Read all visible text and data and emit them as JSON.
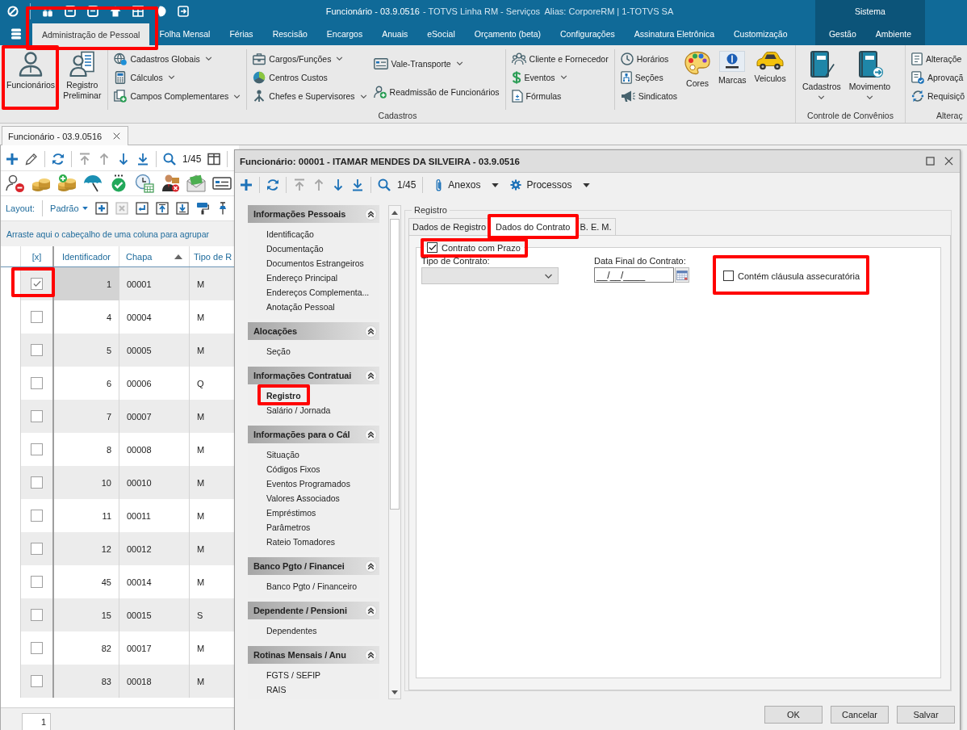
{
  "title_bar": {
    "title": "Funcionário - 03.9.0516",
    "app_info": "- TOTVS Linha RM - Serviços  Alias: CorporeRM | 1-TOTVS SA"
  },
  "ribbon_tabs": [
    {
      "label": "Administração de Pessoal",
      "selected": true,
      "highlighted": true
    },
    {
      "label": "Folha Mensal",
      "selected": false,
      "highlighted": false
    },
    {
      "label": "Férias",
      "selected": false,
      "highlighted": false
    },
    {
      "label": "Rescisão",
      "selected": false,
      "highlighted": false
    },
    {
      "label": "Encargos",
      "selected": false,
      "highlighted": false
    },
    {
      "label": "Anuais",
      "selected": false,
      "highlighted": false
    },
    {
      "label": "eSocial",
      "selected": false,
      "highlighted": false
    },
    {
      "label": "Orçamento (beta)",
      "selected": false,
      "highlighted": false
    },
    {
      "label": "Configurações",
      "selected": false,
      "highlighted": false
    },
    {
      "label": "Assinatura Eletrônica",
      "selected": false,
      "highlighted": false
    },
    {
      "label": "Customização",
      "selected": false,
      "highlighted": false
    }
  ],
  "context_group": {
    "label": "Sistema",
    "tabs": [
      {
        "label": "Gestão",
        "selected": false
      },
      {
        "label": "Ambiente",
        "selected": false
      }
    ]
  },
  "ribbon": {
    "groups": [
      {
        "label": "Cadastros",
        "sections": [
          {
            "columns": [
              {
                "kind": "large",
                "buttons": [
                  {
                    "label": "Funcionários",
                    "dropdown": false,
                    "highlighted": true
                  }
                ]
              },
              {
                "kind": "large",
                "buttons": [
                  {
                    "label": "Registro Preliminar",
                    "dropdown": false
                  }
                ]
              }
            ]
          },
          {
            "columns": [
              {
                "kind": "small",
                "buttons": [
                  {
                    "label": "Cadastros Globais",
                    "dropdown": true
                  },
                  {
                    "label": "Cálculos",
                    "dropdown": true
                  },
                  {
                    "label": "Campos Complementares",
                    "dropdown": true
                  }
                ]
              }
            ]
          },
          {
            "columns": [
              {
                "kind": "small",
                "buttons": [
                  {
                    "label": "Cargos/Funções",
                    "dropdown": true
                  },
                  {
                    "label": "Centros Custos",
                    "dropdown": false
                  },
                  {
                    "label": "Chefes e Supervisores",
                    "dropdown": true
                  }
                ]
              },
              {
                "kind": "small",
                "buttons": [
                  {
                    "label": "Vale-Transporte",
                    "dropdown": true
                  },
                  {
                    "label": "Readmissão de Funcionários",
                    "dropdown": false
                  }
                ]
              }
            ]
          },
          {
            "columns": [
              {
                "kind": "small",
                "buttons": [
                  {
                    "label": "Cliente e Fornecedor",
                    "dropdown": false
                  },
                  {
                    "label": "Eventos",
                    "dropdown": true
                  },
                  {
                    "label": "Fórmulas",
                    "dropdown": false
                  }
                ]
              }
            ]
          },
          {
            "columns": [
              {
                "kind": "small",
                "buttons": [
                  {
                    "label": "Horários",
                    "dropdown": false
                  },
                  {
                    "label": "Seções",
                    "dropdown": false
                  },
                  {
                    "label": "Sindicatos",
                    "dropdown": false
                  }
                ]
              },
              {
                "kind": "large",
                "buttons": [
                  {
                    "label": "Cores",
                    "dropdown": false
                  }
                ]
              },
              {
                "kind": "large",
                "buttons": [
                  {
                    "label": "Marcas",
                    "dropdown": false
                  }
                ]
              },
              {
                "kind": "large",
                "buttons": [
                  {
                    "label": "Veiculos",
                    "dropdown": false
                  }
                ]
              }
            ]
          }
        ]
      },
      {
        "label": "Controle de Convênios",
        "sections": [
          {
            "columns": [
              {
                "kind": "large",
                "buttons": [
                  {
                    "label": "Cadastros",
                    "dropdown": true
                  }
                ]
              },
              {
                "kind": "large",
                "buttons": [
                  {
                    "label": "Movimento",
                    "dropdown": true
                  }
                ]
              }
            ]
          }
        ]
      },
      {
        "label": "Alteraç",
        "sections": [
          {
            "columns": [
              {
                "kind": "small",
                "buttons": [
                  {
                    "label": "Alteraçõe",
                    "dropdown": false
                  },
                  {
                    "label": "Aprovaçã",
                    "dropdown": false
                  },
                  {
                    "label": "Requisiçõ",
                    "dropdown": false
                  }
                ]
              }
            ]
          }
        ]
      }
    ]
  },
  "document_tab": {
    "label": "Funcionário - 03.9.0516"
  },
  "list_panel": {
    "navigation": [
      {
        "kind": "first",
        "disabled": true
      },
      {
        "kind": "previous",
        "disabled": true
      },
      {
        "kind": "next",
        "disabled": false
      },
      {
        "kind": "last",
        "disabled": false
      }
    ],
    "record_counter": "1/45",
    "layout_label": "Layout:",
    "layout_value": "Padrão",
    "group_hint": "Arraste aqui o cabeçalho de uma coluna para agrupar",
    "checkbox_column": {
      "label": "[x]"
    },
    "columns": [
      {
        "label": "Identificador",
        "sorted": false
      },
      {
        "label": "Chapa",
        "sorted": true
      },
      {
        "label": "Tipo de R",
        "sorted": false
      }
    ],
    "rows": [
      {
        "checked": true,
        "selected": true,
        "highlighted": true,
        "cells": [
          "1",
          "00001",
          "M"
        ]
      },
      {
        "checked": false,
        "selected": false,
        "highlighted": false,
        "cells": [
          "4",
          "00004",
          "M"
        ]
      },
      {
        "checked": false,
        "selected": false,
        "highlighted": false,
        "cells": [
          "5",
          "00005",
          "M"
        ]
      },
      {
        "checked": false,
        "selected": false,
        "highlighted": false,
        "cells": [
          "6",
          "00006",
          "Q"
        ]
      },
      {
        "checked": false,
        "selected": false,
        "highlighted": false,
        "cells": [
          "7",
          "00007",
          "M"
        ]
      },
      {
        "checked": false,
        "selected": false,
        "highlighted": false,
        "cells": [
          "8",
          "00008",
          "M"
        ]
      },
      {
        "checked": false,
        "selected": false,
        "highlighted": false,
        "cells": [
          "10",
          "00010",
          "M"
        ]
      },
      {
        "checked": false,
        "selected": false,
        "highlighted": false,
        "cells": [
          "11",
          "00011",
          "M"
        ]
      },
      {
        "checked": false,
        "selected": false,
        "highlighted": false,
        "cells": [
          "12",
          "00012",
          "M"
        ]
      },
      {
        "checked": false,
        "selected": false,
        "highlighted": false,
        "cells": [
          "45",
          "00014",
          "M"
        ]
      },
      {
        "checked": false,
        "selected": false,
        "highlighted": false,
        "cells": [
          "15",
          "00015",
          "S"
        ]
      },
      {
        "checked": false,
        "selected": false,
        "highlighted": false,
        "cells": [
          "82",
          "00017",
          "M"
        ]
      },
      {
        "checked": false,
        "selected": false,
        "highlighted": false,
        "cells": [
          "83",
          "00018",
          "M"
        ]
      }
    ],
    "page_field": "1"
  },
  "dialog": {
    "title": "Funcionário: 00001 - ITAMAR MENDES DA SILVEIRA - 03.9.0516",
    "navigation": [
      {
        "kind": "first",
        "disabled": true
      },
      {
        "kind": "previous",
        "disabled": true
      },
      {
        "kind": "next",
        "disabled": false
      },
      {
        "kind": "last",
        "disabled": false
      }
    ],
    "record_counter": "1/45",
    "menus": [
      {
        "label": "Anexos"
      },
      {
        "label": "Processos"
      }
    ],
    "nav_groups": [
      {
        "label": "Informações Pessoais",
        "expanded": true,
        "items": [
          {
            "label": "Identificação",
            "selected": false
          },
          {
            "label": "Documentação",
            "selected": false
          },
          {
            "label": "Documentos Estrangeiros",
            "selected": false
          },
          {
            "label": "Endereço Principal",
            "selected": false
          },
          {
            "label": "Endereços Complementa...",
            "selected": false
          },
          {
            "label": "Anotação Pessoal",
            "selected": false
          }
        ]
      },
      {
        "label": "Alocações",
        "expanded": true,
        "items": [
          {
            "label": "Seção",
            "selected": false
          }
        ]
      },
      {
        "label": "Informações Contratuai",
        "expanded": true,
        "items": [
          {
            "label": "Registro",
            "selected": true,
            "highlighted": true
          },
          {
            "label": "Salário / Jornada",
            "selected": false,
            "highlighted": false
          }
        ]
      },
      {
        "label": "Informações para o Cál",
        "expanded": true,
        "items": [
          {
            "label": "Situação",
            "selected": false
          },
          {
            "label": "Códigos Fixos",
            "selected": false
          },
          {
            "label": "Eventos Programados",
            "selected": false
          },
          {
            "label": "Valores Associados",
            "selected": false
          },
          {
            "label": "Empréstimos",
            "selected": false
          },
          {
            "label": "Parâmetros",
            "selected": false
          },
          {
            "label": "Rateio Tomadores",
            "selected": false
          }
        ]
      },
      {
        "label": "Banco Pgto / Financei",
        "expanded": true,
        "items": [
          {
            "label": "Banco Pgto / Financeiro",
            "selected": false
          }
        ]
      },
      {
        "label": "Dependente / Pensioni",
        "expanded": true,
        "items": [
          {
            "label": "Dependentes",
            "selected": false
          }
        ]
      },
      {
        "label": "Rotinas Mensais / Anu",
        "expanded": true,
        "items": [
          {
            "label": "FGTS / SEFIP",
            "selected": false
          },
          {
            "label": "RAIS",
            "selected": false
          }
        ]
      }
    ],
    "section_label": "Registro",
    "tabs": [
      {
        "label": "Dados de Registro",
        "selected": false,
        "highlighted": false
      },
      {
        "label": "Dados do Contrato",
        "selected": true,
        "highlighted": true
      },
      {
        "label": "B. E. M.",
        "selected": false,
        "highlighted": false
      }
    ],
    "term_contract": {
      "label": "Contrato com Prazo",
      "checked": true,
      "highlighted": true
    },
    "contract_type": {
      "label": "Tipo de Contrato:",
      "disabled": true
    },
    "end_date": {
      "label": "Data Final do Contrato:",
      "value": "__/__/____"
    },
    "clause": {
      "label": "Contém cláusula assecuratória",
      "checked": false,
      "highlighted": true
    },
    "buttons": [
      {
        "label": "OK"
      },
      {
        "label": "Cancelar"
      },
      {
        "label": "Salvar"
      }
    ]
  }
}
